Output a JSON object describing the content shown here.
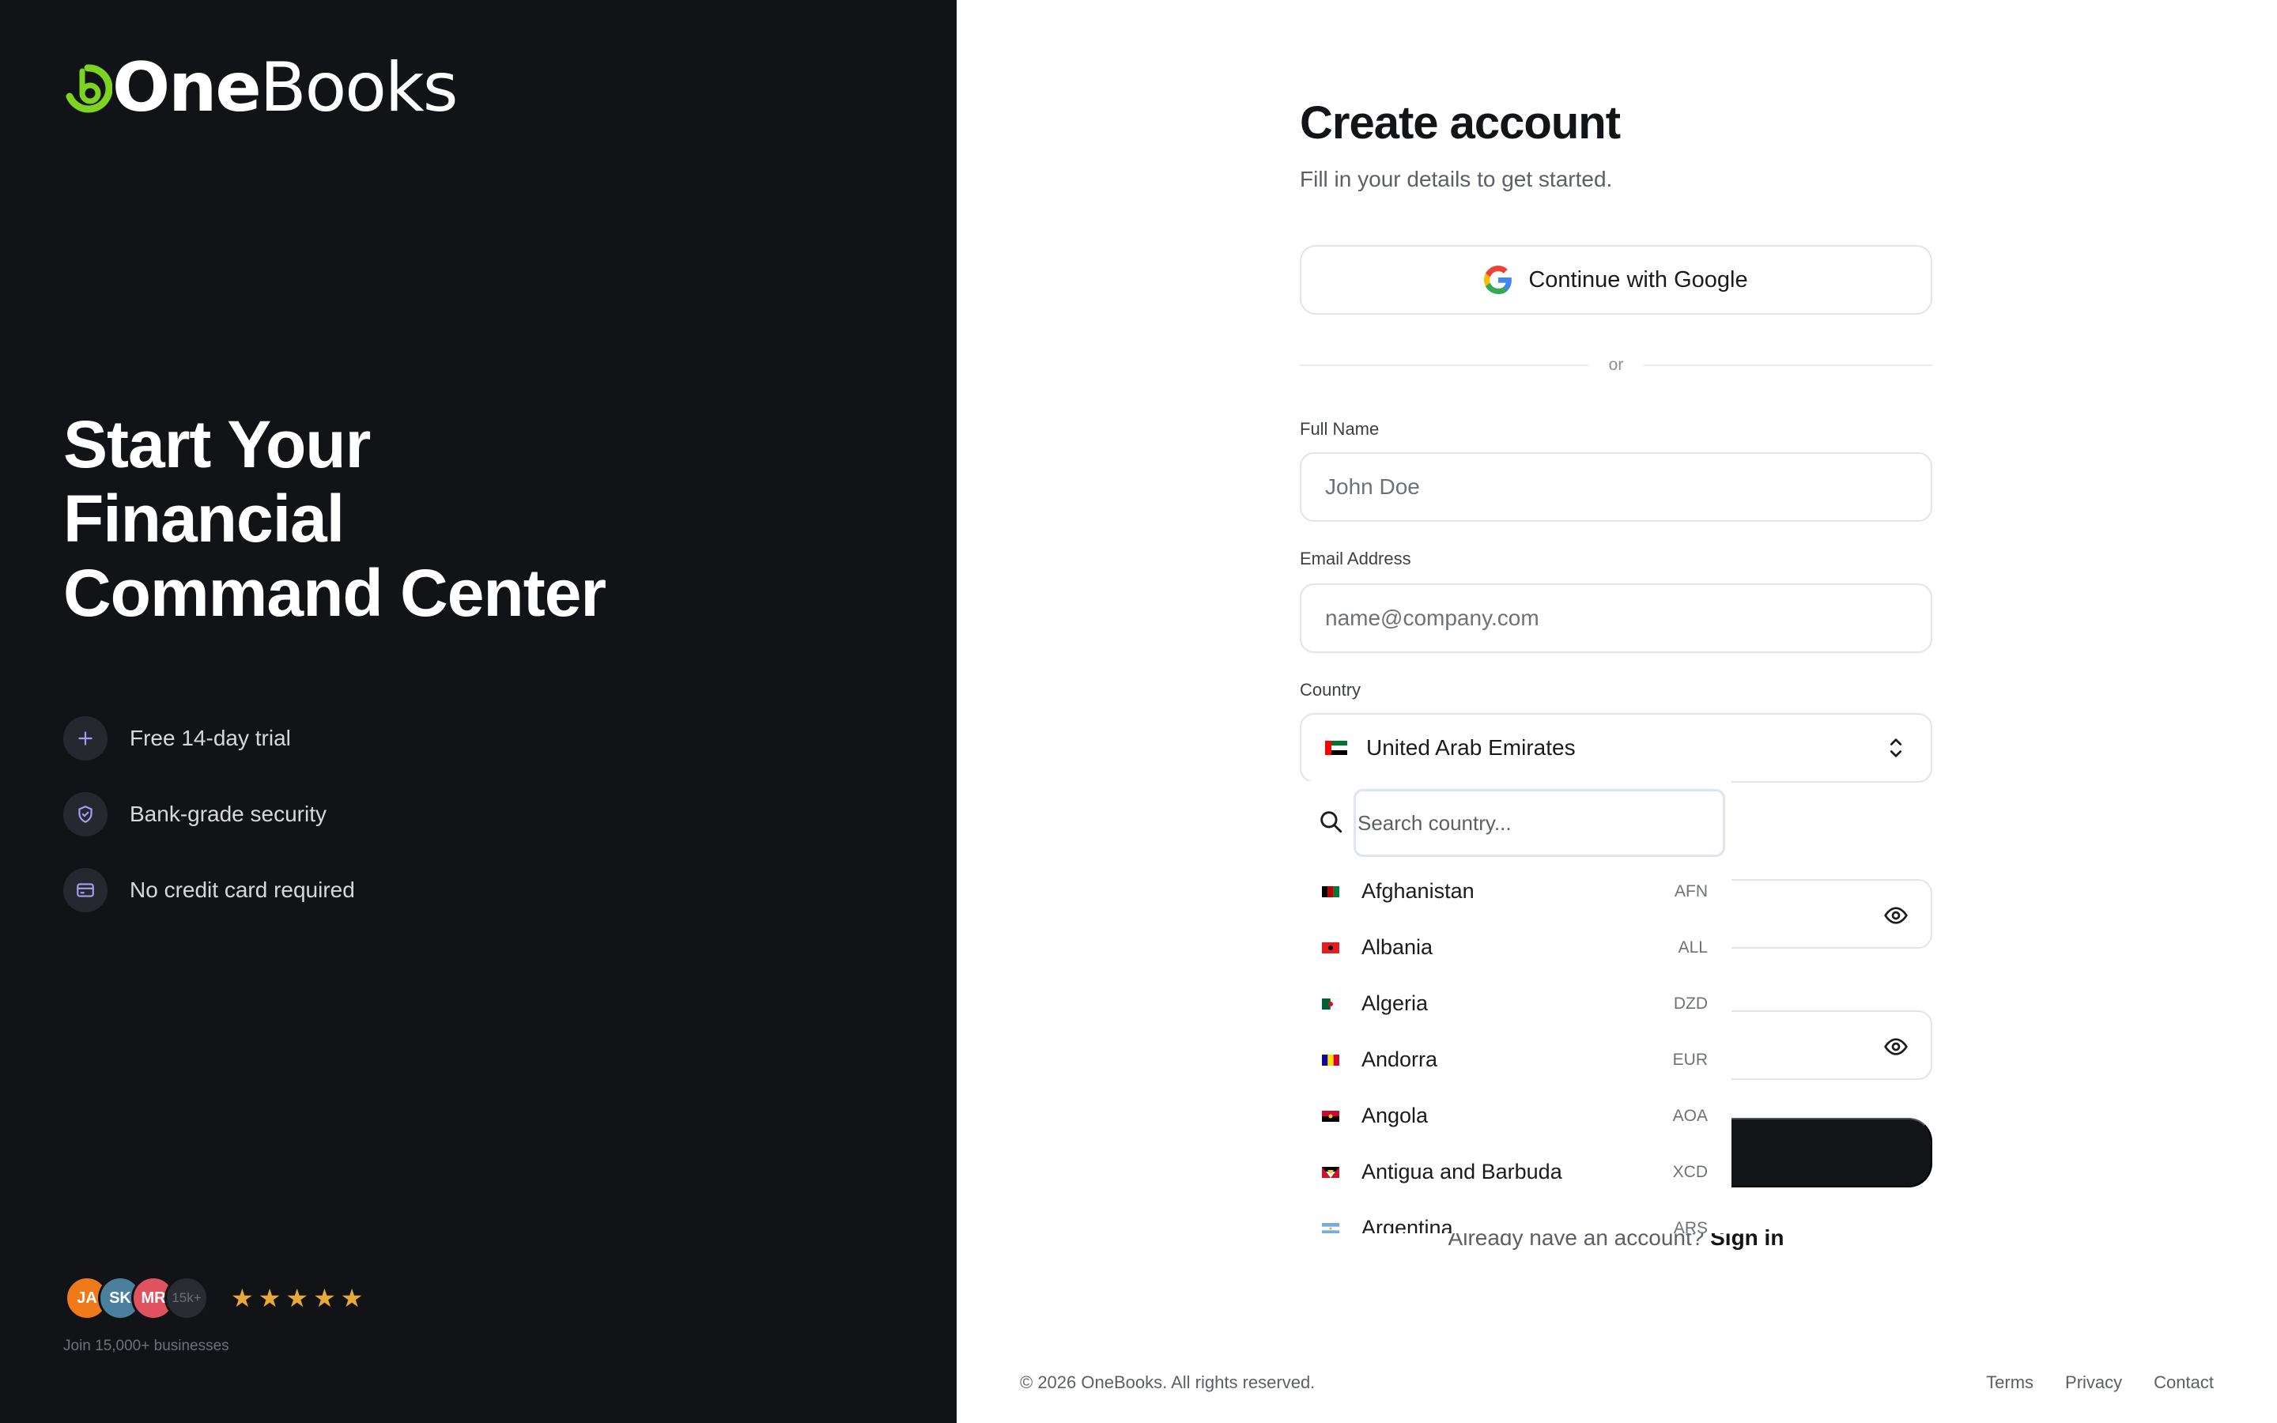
{
  "brand": {
    "name_part1": "One",
    "name_part2": "Books",
    "accent": "#7ed321"
  },
  "hero": {
    "line1": "Start Your",
    "line2": "Financial",
    "line3": "Command Center"
  },
  "features": [
    {
      "label": "Free 14-day trial",
      "icon": "plus-icon"
    },
    {
      "label": "Bank-grade security",
      "icon": "shield-check-icon"
    },
    {
      "label": "No credit card required",
      "icon": "credit-card-icon"
    }
  ],
  "social": {
    "avatars": [
      {
        "initials": "JA",
        "color": "#f07a1a"
      },
      {
        "initials": "SK",
        "color": "#4b7f9e"
      },
      {
        "initials": "MR",
        "color": "#e0525e"
      },
      {
        "initials": "15k+",
        "color": "#2a2c33"
      }
    ],
    "stars": [
      "★",
      "★",
      "★",
      "★",
      "★"
    ],
    "caption": "Join 15,000+ businesses"
  },
  "form": {
    "title": "Create account",
    "subtitle": "Fill in your details to get started.",
    "google_label": "Continue with Google",
    "or_label": "or",
    "full_name_label": "Full Name",
    "full_name_placeholder": "John Doe",
    "email_label": "Email Address",
    "email_placeholder": "name@company.com",
    "country_label": "Country",
    "country_value": "United Arab Emirates",
    "signin_prompt": "Already have an account?",
    "signin_link": "Sign in"
  },
  "dropdown": {
    "search_placeholder": "Search country...",
    "options": [
      {
        "name": "Afghanistan",
        "code": "AFN"
      },
      {
        "name": "Albania",
        "code": "ALL"
      },
      {
        "name": "Algeria",
        "code": "DZD"
      },
      {
        "name": "Andorra",
        "code": "EUR"
      },
      {
        "name": "Angola",
        "code": "AOA"
      },
      {
        "name": "Antigua and Barbuda",
        "code": "XCD"
      },
      {
        "name": "Argentina",
        "code": "ARS"
      }
    ]
  },
  "footer": {
    "copyright": "© 2026 OneBooks. All rights reserved.",
    "links": [
      "Terms",
      "Privacy",
      "Contact"
    ]
  }
}
